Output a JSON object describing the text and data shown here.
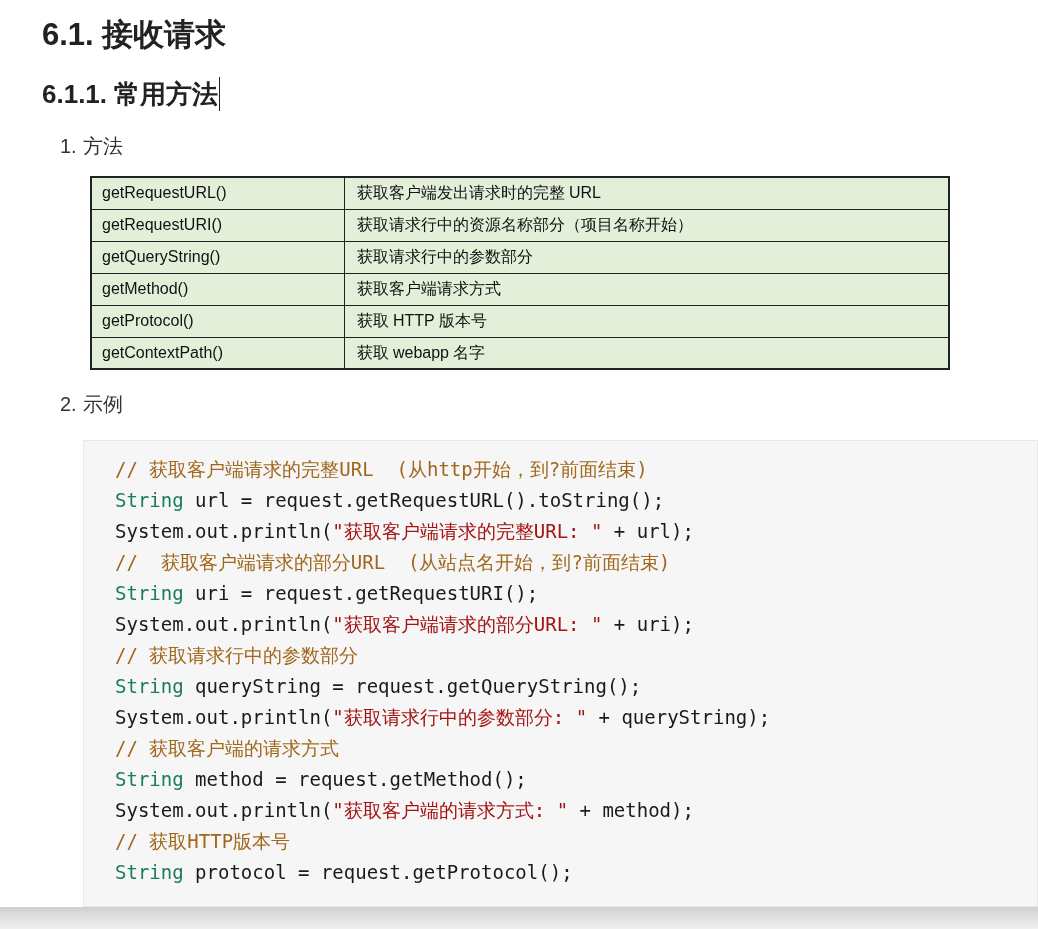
{
  "heading": "6.1. 接收请求",
  "subheading": "6.1.1. 常用方法",
  "list": [
    {
      "number": "1.",
      "label": "方法"
    },
    {
      "number": "2.",
      "label": "示例"
    }
  ],
  "table": {
    "rows": [
      {
        "method": "getRequestURL()",
        "description": "获取客户端发出请求时的完整 URL"
      },
      {
        "method": "getRequestURI()",
        "description": "获取请求行中的资源名称部分（项目名称开始）"
      },
      {
        "method": "getQueryString()",
        "description": "获取请求行中的参数部分"
      },
      {
        "method": "getMethod()",
        "description": "获取客户端请求方式"
      },
      {
        "method": "getProtocol()",
        "description": "获取 HTTP 版本号"
      },
      {
        "method": "getContextPath()",
        "description": "获取 webapp 名字"
      }
    ]
  },
  "code": [
    [
      {
        "kind": "comment",
        "text": "// 获取客户端请求的完整URL  (从http开始，到?前面结束)"
      }
    ],
    [
      {
        "kind": "type",
        "text": "String"
      },
      {
        "kind": "plain",
        "text": " url = request.getRequestURL().toString();"
      }
    ],
    [
      {
        "kind": "plain",
        "text": "System.out.println("
      },
      {
        "kind": "string",
        "text": "\"获取客户端请求的完整URL: \""
      },
      {
        "kind": "plain",
        "text": " + url);"
      }
    ],
    [
      {
        "kind": "comment",
        "text": "//  获取客户端请求的部分URL  (从站点名开始，到?前面结束)"
      }
    ],
    [
      {
        "kind": "type",
        "text": "String"
      },
      {
        "kind": "plain",
        "text": " uri = request.getRequestURI();"
      }
    ],
    [
      {
        "kind": "plain",
        "text": "System.out.println("
      },
      {
        "kind": "string",
        "text": "\"获取客户端请求的部分URL: \""
      },
      {
        "kind": "plain",
        "text": " + uri);"
      }
    ],
    [
      {
        "kind": "comment",
        "text": "// 获取请求行中的参数部分"
      }
    ],
    [
      {
        "kind": "type",
        "text": "String"
      },
      {
        "kind": "plain",
        "text": " queryString = request.getQueryString();"
      }
    ],
    [
      {
        "kind": "plain",
        "text": "System.out.println("
      },
      {
        "kind": "string",
        "text": "\"获取请求行中的参数部分: \""
      },
      {
        "kind": "plain",
        "text": " + queryString);"
      }
    ],
    [
      {
        "kind": "comment",
        "text": "// 获取客户端的请求方式"
      }
    ],
    [
      {
        "kind": "type",
        "text": "String"
      },
      {
        "kind": "plain",
        "text": " method = request.getMethod();"
      }
    ],
    [
      {
        "kind": "plain",
        "text": "System.out.println("
      },
      {
        "kind": "string",
        "text": "\"获取客户端的请求方式: \""
      },
      {
        "kind": "plain",
        "text": " + method);"
      }
    ],
    [
      {
        "kind": "comment",
        "text": "// 获取HTTP版本号"
      }
    ],
    [
      {
        "kind": "type",
        "text": "String"
      },
      {
        "kind": "plain",
        "text": " protocol = request.getProtocol();"
      }
    ]
  ]
}
